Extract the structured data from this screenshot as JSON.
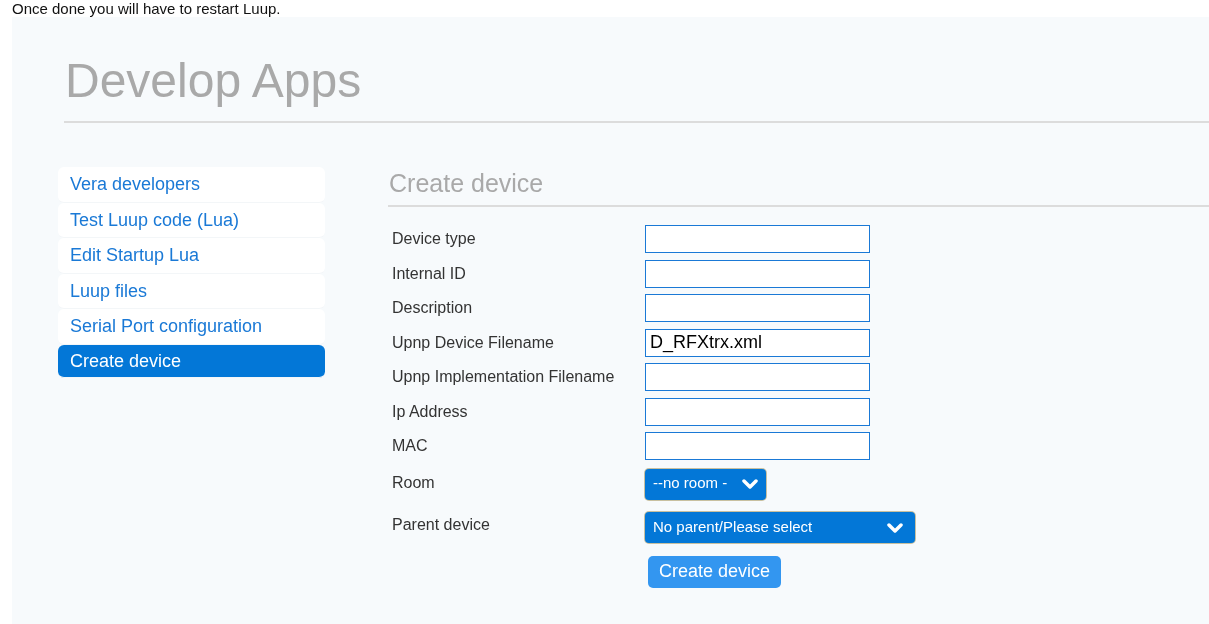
{
  "intro_text": "Once done you will have to restart Luup.",
  "page_title": "Develop Apps",
  "sidebar": {
    "items": [
      {
        "label": "Vera developers",
        "selected": false
      },
      {
        "label": "Test Luup code (Lua)",
        "selected": false
      },
      {
        "label": "Edit Startup Lua",
        "selected": false
      },
      {
        "label": "Luup files",
        "selected": false
      },
      {
        "label": "Serial Port configuration",
        "selected": false
      },
      {
        "label": "Create device",
        "selected": true
      }
    ]
  },
  "form": {
    "title": "Create device",
    "fields": [
      {
        "kind": "text",
        "label": "Device type"
      },
      {
        "kind": "text",
        "label": "Internal ID"
      },
      {
        "kind": "text",
        "label": "Description"
      },
      {
        "kind": "text",
        "label": "Upnp Device Filename",
        "value": "D_RFXtrx.xml"
      },
      {
        "kind": "text",
        "label": "Upnp Implementation Filename"
      },
      {
        "kind": "text",
        "label": "Ip Address"
      },
      {
        "kind": "text",
        "label": "MAC"
      },
      {
        "kind": "select",
        "label": "Room",
        "value": "--no room -"
      },
      {
        "kind": "select",
        "label": "Parent device",
        "value": "No parent/Please select"
      }
    ],
    "submit": "Create device"
  }
}
